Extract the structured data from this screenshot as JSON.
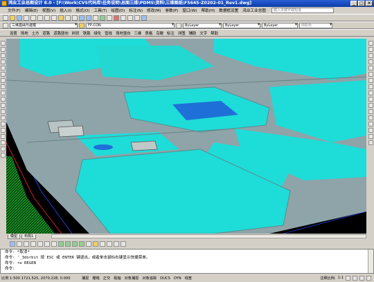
{
  "window": {
    "title": "鸿业工业总图设计 8.0 - [F:\\Work\\CVS代码库\\任务说明\\总图三维\\PDMS\\资料\\三维图纸\\F5645-Z0202-01_Rev1.dwg]",
    "controls": [
      "_",
      "□",
      "×"
    ]
  },
  "menu": {
    "items": [
      "文件(F)",
      "编辑(E)",
      "视图(V)",
      "插入(I)",
      "格式(O)",
      "工具(T)",
      "绘图(D)",
      "标注(N)",
      "修改(M)",
      "参数(P)",
      "窗口(W)",
      "帮助(H)",
      "数据框设置",
      "鸿业工业总图"
    ],
    "search_placeholder": "键入关键字或短语"
  },
  "toolbar2": {
    "workspace": "三维基础与建模",
    "layer": "FP-CON",
    "color": "ByLayer",
    "linetype": "ByLayer",
    "lineweight": "ByLayer",
    "plotstyle": "随颜色"
  },
  "toolbar3": {
    "items": [
      "设置",
      "场地",
      "土方",
      "道路",
      "道路竖向",
      "树状",
      "铁路",
      "绿化",
      "管线",
      "场地竖向",
      "三维",
      "表格",
      "鸟瞰",
      "标注",
      "详图",
      "辅助",
      "文字",
      "帮助"
    ]
  },
  "layout_tabs": [
    "模型",
    "布局1"
  ],
  "command": {
    "lines": [
      "命令: *取消*",
      "命令: '_3dorbit 按 ESC 或 ENTER 键退出，或者单击鼠标右键显示快捷菜单。",
      "命令: re REGEN"
    ],
    "prompt": "命令:"
  },
  "status": {
    "coords": "比例 1:500  1721.525, 2070.228, 0.000",
    "toggles": [
      "捕捉",
      "栅格",
      "正交",
      "极轴",
      "对象捕捉",
      "对象追踪",
      "DUCS",
      "DYN",
      "线宽"
    ],
    "annotation_scale_label": "注释比例:",
    "annotation_scale": "1:1"
  },
  "colors": {
    "title_bar": "#0a3ba8",
    "cyan": "#1edcd8",
    "road": "#8ea4a8",
    "blue": "#1e6fd8"
  }
}
